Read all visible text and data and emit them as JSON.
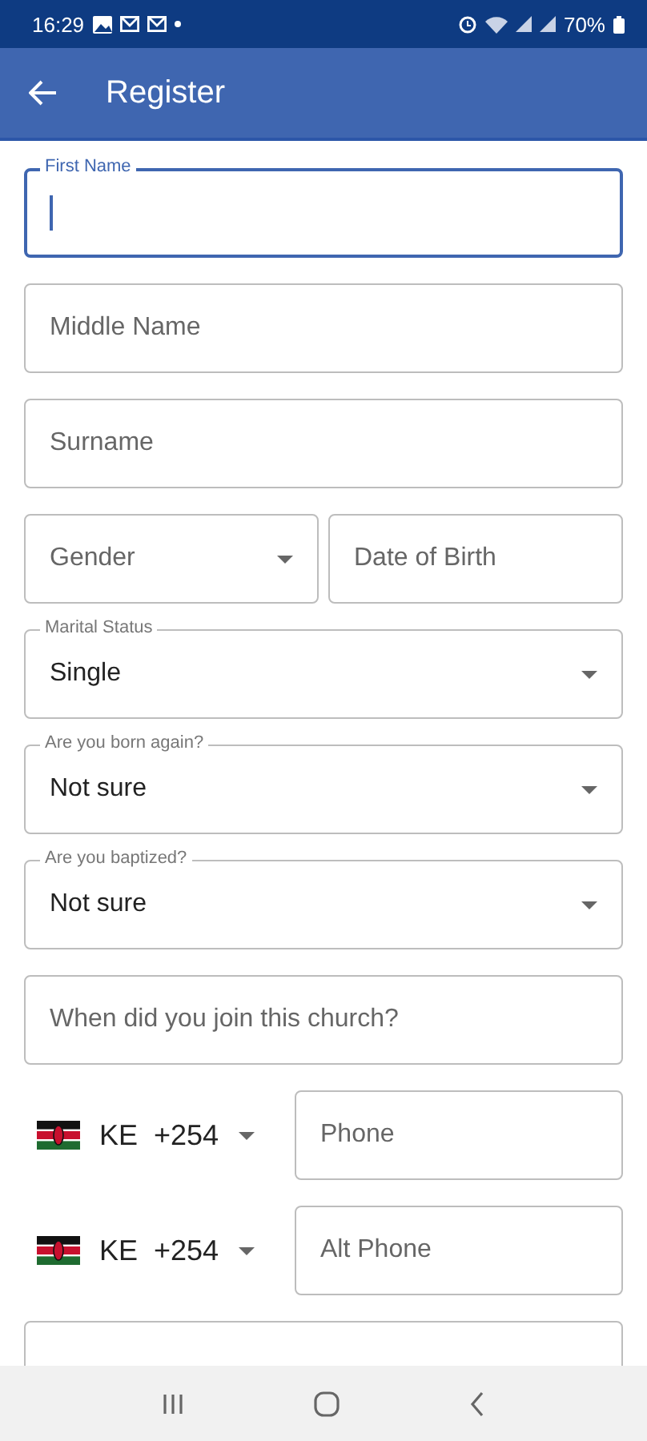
{
  "status_bar": {
    "time": "16:29",
    "battery": "70%"
  },
  "app_bar": {
    "title": "Register"
  },
  "form": {
    "fields": [
      {
        "kind": "text",
        "label": "First Name",
        "focused": true
      },
      {
        "kind": "text",
        "placeholder": "Middle Name",
        "focused": false
      },
      {
        "kind": "text",
        "placeholder": "Surname",
        "focused": false
      },
      {
        "kind": "pair",
        "items": [
          {
            "kind": "select",
            "placeholder": "Gender"
          },
          {
            "kind": "text",
            "placeholder": "Date of Birth",
            "focused": false
          }
        ]
      },
      {
        "kind": "select",
        "label": "Marital Status",
        "value": "Single"
      },
      {
        "kind": "select",
        "label": "Are you born again?",
        "value": "Not sure"
      },
      {
        "kind": "select",
        "label": "Are you baptized?",
        "value": "Not sure"
      },
      {
        "kind": "text",
        "placeholder": "When did you join this church?",
        "focused": false
      },
      {
        "kind": "phone",
        "country": "KE",
        "code": "+254",
        "placeholder": "Phone"
      },
      {
        "kind": "phone",
        "country": "KE",
        "code": "+254",
        "placeholder": "Alt Phone"
      },
      {
        "kind": "text",
        "focused": false
      }
    ]
  }
}
